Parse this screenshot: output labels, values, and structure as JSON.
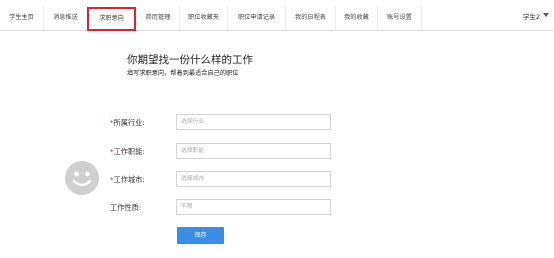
{
  "nav": {
    "items": [
      {
        "label": "学生主页"
      },
      {
        "label": "消息推送"
      },
      {
        "label": "求职意向"
      },
      {
        "label": "简历管理"
      },
      {
        "label": "职位收藏夹"
      },
      {
        "label": "职位申请记录"
      },
      {
        "label": "我的日程表"
      },
      {
        "label": "我的收藏"
      },
      {
        "label": "账号设置"
      }
    ],
    "active_index": 2,
    "active_border_color": "#d9262c",
    "user_name": "学生2"
  },
  "main": {
    "heading": "你期望找一份什么样的工作",
    "subheading": "填写求职意向，帮着到最适合自己的职位"
  },
  "form": {
    "required_mark": "*",
    "industry": {
      "label": "所属行业:",
      "placeholder": "选择行业"
    },
    "function": {
      "label": "工作职能:",
      "placeholder": "选择职能"
    },
    "city": {
      "label": "工作城市:",
      "placeholder": "选择城市"
    },
    "nature": {
      "label": "工作性质:",
      "placeholder": "不限"
    },
    "save_label": "保存",
    "save_color": "#3a8ee6"
  },
  "icons": {
    "avatar": "smiley-face-icon",
    "user_menu": "caret-down-icon"
  }
}
